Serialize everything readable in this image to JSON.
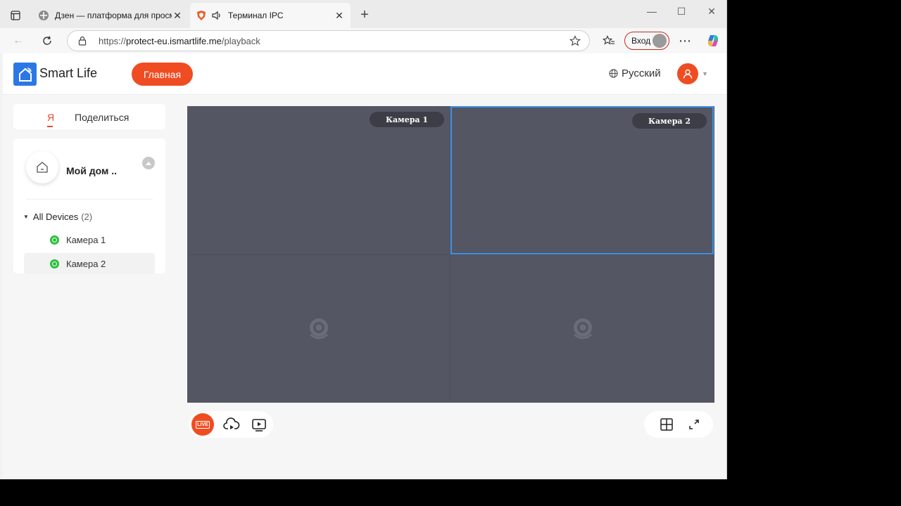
{
  "browser": {
    "tabs": [
      {
        "title": "Дзен — платформа для просмотра",
        "active": false
      },
      {
        "title": "Терминал IPC",
        "active": true
      }
    ],
    "url_prefix": "https://",
    "url_host": "protect-eu.ismartlife.me",
    "url_path": "/playback",
    "login_label": "Вход",
    "accent": "#c42b1c"
  },
  "app": {
    "brand": "Smart Life",
    "home_button": "Главная",
    "language": "Русский",
    "accent": "#f04c22"
  },
  "sidebar": {
    "tabs": [
      {
        "label": "Я",
        "active": true
      },
      {
        "label": "Поделиться",
        "active": false
      }
    ],
    "home_name": "Мой дом ..",
    "group_label": "All Devices",
    "group_count": "(2)",
    "devices": [
      {
        "name": "Камера 1",
        "status": "online",
        "selected": false
      },
      {
        "name": "Камера 2",
        "status": "online",
        "selected": true
      }
    ]
  },
  "grid": {
    "cells": [
      {
        "label": "Камера 1",
        "selected": false
      },
      {
        "label": "Камера 2",
        "selected": true
      },
      {
        "label": "",
        "selected": false
      },
      {
        "label": "",
        "selected": false
      }
    ],
    "selected_border_color": "#3a90e6",
    "background_color": "#545664"
  },
  "controls": {
    "live_label": "LIVE",
    "icons": [
      "live-icon",
      "cloud-playback-icon",
      "local-playback-icon",
      "grid-layout-icon",
      "fullscreen-icon"
    ]
  }
}
